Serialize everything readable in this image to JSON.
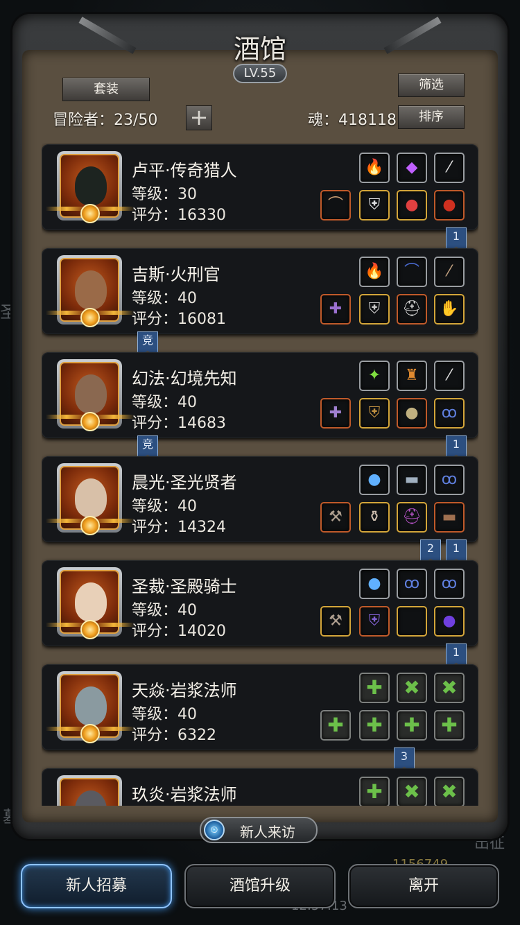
{
  "header": {
    "title": "酒馆",
    "level": "LV.55",
    "set_button": "套装",
    "filter_button": "筛选",
    "sort_button": "排序",
    "adventurers_label": "冒险者：23/50",
    "add_symbol": "+",
    "soul_label": "魂：418118"
  },
  "heroes": [
    {
      "name": "卢平·传奇猎人",
      "level": "等级：30",
      "score": "评分：16330"
    },
    {
      "name": "吉斯·火刑官",
      "level": "等级：40",
      "score": "评分：16081"
    },
    {
      "name": "幻法·幻境先知",
      "level": "等级：40",
      "score": "评分：14683"
    },
    {
      "name": "晨光·圣光贤者",
      "level": "等级：40",
      "score": "评分：14324"
    },
    {
      "name": "圣裁·圣殿骑士",
      "level": "等级：40",
      "score": "评分：14020"
    },
    {
      "name": "天焱·岩浆法师",
      "level": "等级：40",
      "score": "评分：6322"
    },
    {
      "name": "玖炎·岩浆法师",
      "level": "",
      "score": ""
    }
  ],
  "ribbons": {
    "r1": "1",
    "r2": "竞",
    "r3": "竞",
    "r4": "1",
    "r5": "2",
    "r6": "1",
    "r7": "1",
    "r8": "3"
  },
  "icons": {
    "fire": "fire-orb-icon",
    "gem": "purple-gem-icon",
    "rod": "rod-icon",
    "crossbow": "crossbow-icon",
    "armor": "armor-icon",
    "amulet": "amulet-icon",
    "ring": "ring-icon",
    "add": "plus-icon"
  },
  "slot_glyphs": {
    "fire": "🔥",
    "gem": "◆",
    "rod": "⁄",
    "bow": "⌒",
    "wing": "✦",
    "staff": "✚",
    "armor": "⛨",
    "helm": "⛑",
    "arm": "✋",
    "orb": "●",
    "lamp": "♜",
    "chain": "ꝏ",
    "book": "▬",
    "axe": "⚒",
    "robe": "⚱",
    "plus": "✚",
    "x": "✖"
  },
  "footer": {
    "visit_label": "新人来访",
    "visit_icon": "⏲",
    "recruit": "新人招募",
    "upgrade": "酒馆升级",
    "leave": "离开"
  },
  "background": {
    "left_char": "圣",
    "left_char2": "墓",
    "right_text": "出征",
    "gold": "1156749",
    "time": "12:57:13"
  },
  "colors": {
    "frame_inner": "#5a4f40",
    "card_bg": "#15171a",
    "active_button_glow": "#3d8ee0",
    "ribbon": "#2c4f80"
  }
}
